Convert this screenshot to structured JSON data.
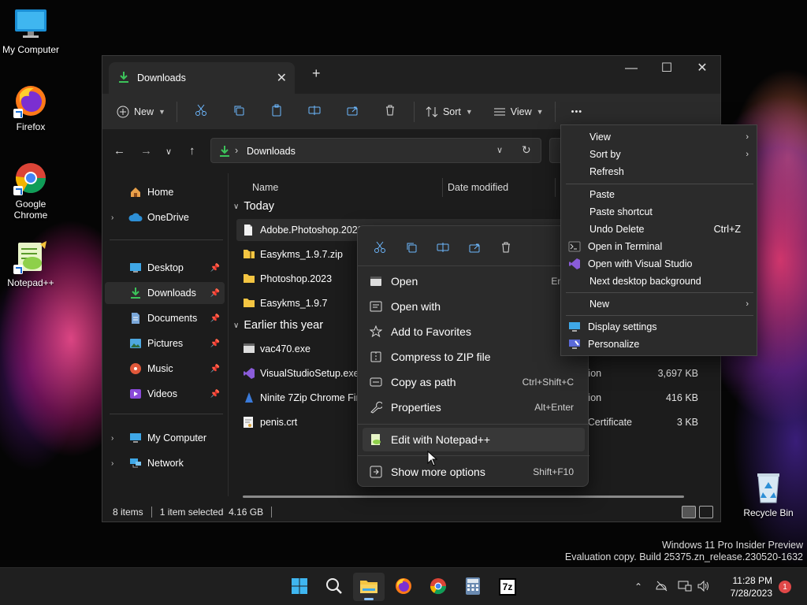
{
  "desktop": {
    "icons": [
      {
        "label": "My Computer"
      },
      {
        "label": "Firefox"
      },
      {
        "label": "Google Chrome"
      },
      {
        "label": "Notepad++"
      },
      {
        "label": "Recycle Bin"
      }
    ]
  },
  "window": {
    "tab_title": "Downloads",
    "new_tab": "+",
    "controls": {
      "minimize": "—",
      "maximize": "☐",
      "close": "✕"
    }
  },
  "toolbar": {
    "new_label": "New",
    "sort_label": "Sort",
    "view_label": "View",
    "more": "•••"
  },
  "address": {
    "path_sep": "›",
    "current": "Downloads"
  },
  "sidebar": {
    "items": [
      {
        "label": "Home"
      },
      {
        "label": "OneDrive"
      },
      {
        "label": "Desktop"
      },
      {
        "label": "Downloads"
      },
      {
        "label": "Documents"
      },
      {
        "label": "Pictures"
      },
      {
        "label": "Music"
      },
      {
        "label": "Videos"
      },
      {
        "label": "My Computer"
      },
      {
        "label": "Network"
      }
    ]
  },
  "columns": {
    "name": "Name",
    "date": "Date modified"
  },
  "groups": {
    "today": "Today",
    "earlier": "Earlier this year"
  },
  "files": [
    {
      "name": "Adobe.Photoshop.2023",
      "type": "",
      "size": ""
    },
    {
      "name": "Easykms_1.9.7.zip",
      "type": "",
      "size": ""
    },
    {
      "name": "Photoshop.2023",
      "type": "",
      "size": ""
    },
    {
      "name": "Easykms_1.9.7",
      "type": "",
      "size": ""
    },
    {
      "name": "vac470.exe",
      "type": "",
      "size": ""
    },
    {
      "name": "VisualStudioSetup.exe",
      "type": "ation",
      "size": "3,697 KB"
    },
    {
      "name": "Ninite 7Zip Chrome Fire",
      "type": "ation",
      "size": "416 KB"
    },
    {
      "name": "penis.crt",
      "type": "y Certificate",
      "size": "3 KB"
    }
  ],
  "status": {
    "count": "8 items",
    "selection": "1 item selected  4.16 GB"
  },
  "context_menu": {
    "items": [
      {
        "label": "Open",
        "shortcut": "Enter"
      },
      {
        "label": "Open with",
        "shortcut": ""
      },
      {
        "label": "Add to Favorites",
        "shortcut": ""
      },
      {
        "label": "Compress to ZIP file",
        "shortcut": ""
      },
      {
        "label": "Copy as path",
        "shortcut": "Ctrl+Shift+C"
      },
      {
        "label": "Properties",
        "shortcut": "Alt+Enter"
      },
      {
        "label": "Edit with Notepad++",
        "shortcut": ""
      },
      {
        "label": "Show more options",
        "shortcut": "Shift+F10"
      }
    ]
  },
  "view_menu": {
    "items": [
      {
        "label": "View",
        "shortcut": ""
      },
      {
        "label": "Sort by",
        "shortcut": ""
      },
      {
        "label": "Refresh",
        "shortcut": ""
      },
      {
        "label": "Paste",
        "shortcut": ""
      },
      {
        "label": "Paste shortcut",
        "shortcut": ""
      },
      {
        "label": "Undo Delete",
        "shortcut": "Ctrl+Z"
      },
      {
        "label": "Open in Terminal",
        "shortcut": ""
      },
      {
        "label": "Open with Visual Studio",
        "shortcut": ""
      },
      {
        "label": "Next desktop background",
        "shortcut": ""
      },
      {
        "label": "New",
        "shortcut": ""
      },
      {
        "label": "Display settings",
        "shortcut": ""
      },
      {
        "label": "Personalize",
        "shortcut": ""
      }
    ]
  },
  "watermark": {
    "line1": "Windows 11 Pro Insider Preview",
    "line2": "Evaluation copy. Build 25375.zn_release.230520-1632"
  },
  "taskbar": {
    "time": "11:28 PM",
    "date": "7/28/2023",
    "notifications": "1",
    "sevenzip": "7z"
  },
  "colors": {
    "accent": "#60cdff",
    "folder": "#f4c542",
    "download_green": "#3cc35a"
  }
}
